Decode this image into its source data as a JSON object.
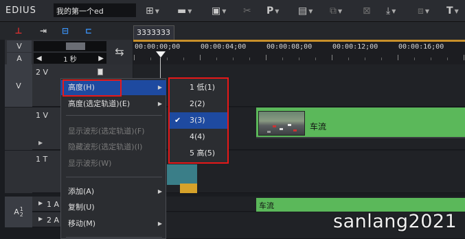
{
  "app": {
    "logo": "EDIUS",
    "project_name": "我的第一个ed"
  },
  "timeline_tab": "3333333",
  "header": {
    "v_label": "V",
    "a_label": "A",
    "scale_value": "1 秒"
  },
  "ruler": {
    "timecodes": [
      "00:00:00;00",
      "00:00:04;00",
      "00:00:08;00",
      "00:00:12;00",
      "00:00:16;00"
    ]
  },
  "tracks": {
    "v_group": "V",
    "v2": "2 V",
    "v1": "1 V",
    "t1": "1 T",
    "a_group": "A",
    "a_group_sub": "1",
    "a_group_sub2": "2",
    "a1": "1 A",
    "a2": "2 A"
  },
  "clips": {
    "video_clip_label": "车流",
    "audio_clip_label": "车流"
  },
  "context_menu": {
    "items": [
      {
        "label": "高度(H)",
        "mnemonic": "H",
        "enabled": true,
        "submenu": true
      },
      {
        "label": "高度(选定轨道)(E)",
        "mnemonic": "E",
        "enabled": true,
        "submenu": true
      },
      {
        "label": "显示波形(选定轨道)(F)",
        "mnemonic": "F",
        "enabled": false,
        "submenu": false
      },
      {
        "label": "隐藏波形(选定轨道)(I)",
        "mnemonic": "I",
        "enabled": false,
        "submenu": false
      },
      {
        "label": "显示波形(W)",
        "mnemonic": "W",
        "enabled": false,
        "submenu": false
      },
      {
        "label": "添加(A)",
        "mnemonic": "A",
        "enabled": true,
        "submenu": true
      },
      {
        "label": "复制(U)",
        "mnemonic": "U",
        "enabled": true,
        "submenu": false
      },
      {
        "label": "移动(M)",
        "mnemonic": "M",
        "enabled": true,
        "submenu": true
      }
    ]
  },
  "height_submenu": {
    "items": [
      {
        "label": "1 低(1)",
        "checked": false
      },
      {
        "label": "2(2)",
        "checked": false
      },
      {
        "label": "3(3)",
        "checked": true
      },
      {
        "label": "4(4)",
        "checked": false
      },
      {
        "label": "5 高(5)",
        "checked": false
      }
    ]
  },
  "watermark": "sanlang2021",
  "colors": {
    "menu_highlight": "#1e4aa0",
    "clip_green": "#5bb85a",
    "annotation_red": "#e81818",
    "ruler_accent": "#c8902a"
  }
}
